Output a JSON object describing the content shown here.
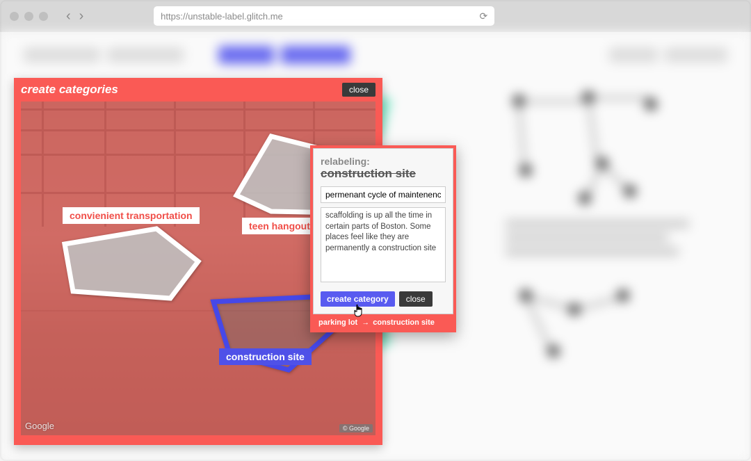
{
  "browser": {
    "url": "https://unstable-label.glitch.me",
    "refresh_icon": "⟳"
  },
  "panel": {
    "title": "create categories",
    "close_label": "close",
    "tags": {
      "convenient": "convienient transportation",
      "hangout": "teen hangout s",
      "construction": "construction site"
    },
    "attribution": "Google",
    "copyright": "© Google"
  },
  "dialog": {
    "heading": "relabeling:",
    "old_label": "construction site",
    "new_label_value": "permenant cycle of maintenence",
    "description_value": "scaffolding is up all the time in certain parts of Boston. Some places feel like they are permanently a construction site",
    "create_label": "create category",
    "close_label": "close",
    "breadcrumb_from": "parking lot",
    "breadcrumb_to": "construction site"
  }
}
